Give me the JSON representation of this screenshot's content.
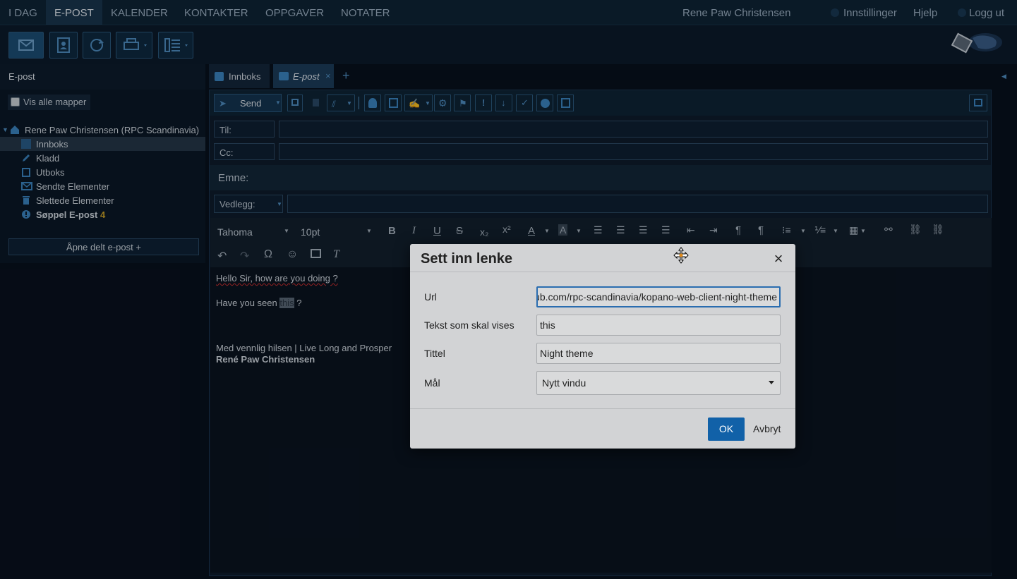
{
  "topnav": {
    "tabs": [
      "I DAG",
      "E-POST",
      "KALENDER",
      "KONTAKTER",
      "OPPGAVER",
      "NOTATER"
    ],
    "active_tab": "E-POST",
    "user_name": "Rene Paw Christensen",
    "settings": "Innstillinger",
    "help": "Hjelp",
    "logout": "Logg ut"
  },
  "sidebar": {
    "title": "E-post",
    "show_all_folders": "Vis alle mapper",
    "account": "Rene Paw Christensen (RPC Scandinavia)",
    "folders": [
      {
        "label": "Innboks",
        "selected": true,
        "icon": "inbox-icon"
      },
      {
        "label": "Kladd",
        "icon": "pencil-icon"
      },
      {
        "label": "Utboks",
        "icon": "outbox-icon"
      },
      {
        "label": "Sendte Elementer",
        "icon": "sent-icon"
      },
      {
        "label": "Slettede Elementer",
        "icon": "trash-icon"
      },
      {
        "label": "Søppel E-post",
        "count": "4",
        "icon": "junk-icon"
      }
    ],
    "open_shared": "Åpne delt e-post +"
  },
  "main_tabs": {
    "tab1": "Innboks",
    "tab2": "E-post",
    "add": "+"
  },
  "compose": {
    "send_label": "Send",
    "to_label": "Til:",
    "cc_label": "Cc:",
    "subject_label": "Emne:",
    "attachment_label": "Vedlegg:",
    "font_family": "Tahoma",
    "font_size": "10pt",
    "body": {
      "line1": "Hello Sir, how are you doing ?",
      "line2_prefix": "Have you seen ",
      "line2_link": "this",
      "line2_suffix": " ?",
      "sign1": "Med vennlig hilsen | Live Long and Prosper",
      "sign2": "René Paw Christensen"
    }
  },
  "dialog": {
    "title": "Sett inn lenke",
    "close": "×",
    "url_label": "Url",
    "url_value": "https://github.com/rpc-scandinavia/kopano-web-client-night-theme",
    "text_label": "Tekst som skal vises",
    "text_value": "this",
    "title_label": "Tittel",
    "title_value": "Night theme",
    "target_label": "Mål",
    "target_value": "Nytt vindu",
    "ok": "OK",
    "cancel": "Avbryt"
  },
  "colors": {
    "accent": "#1161a8",
    "background": "#08111e",
    "dialog_bg": "#d2d3d5"
  }
}
